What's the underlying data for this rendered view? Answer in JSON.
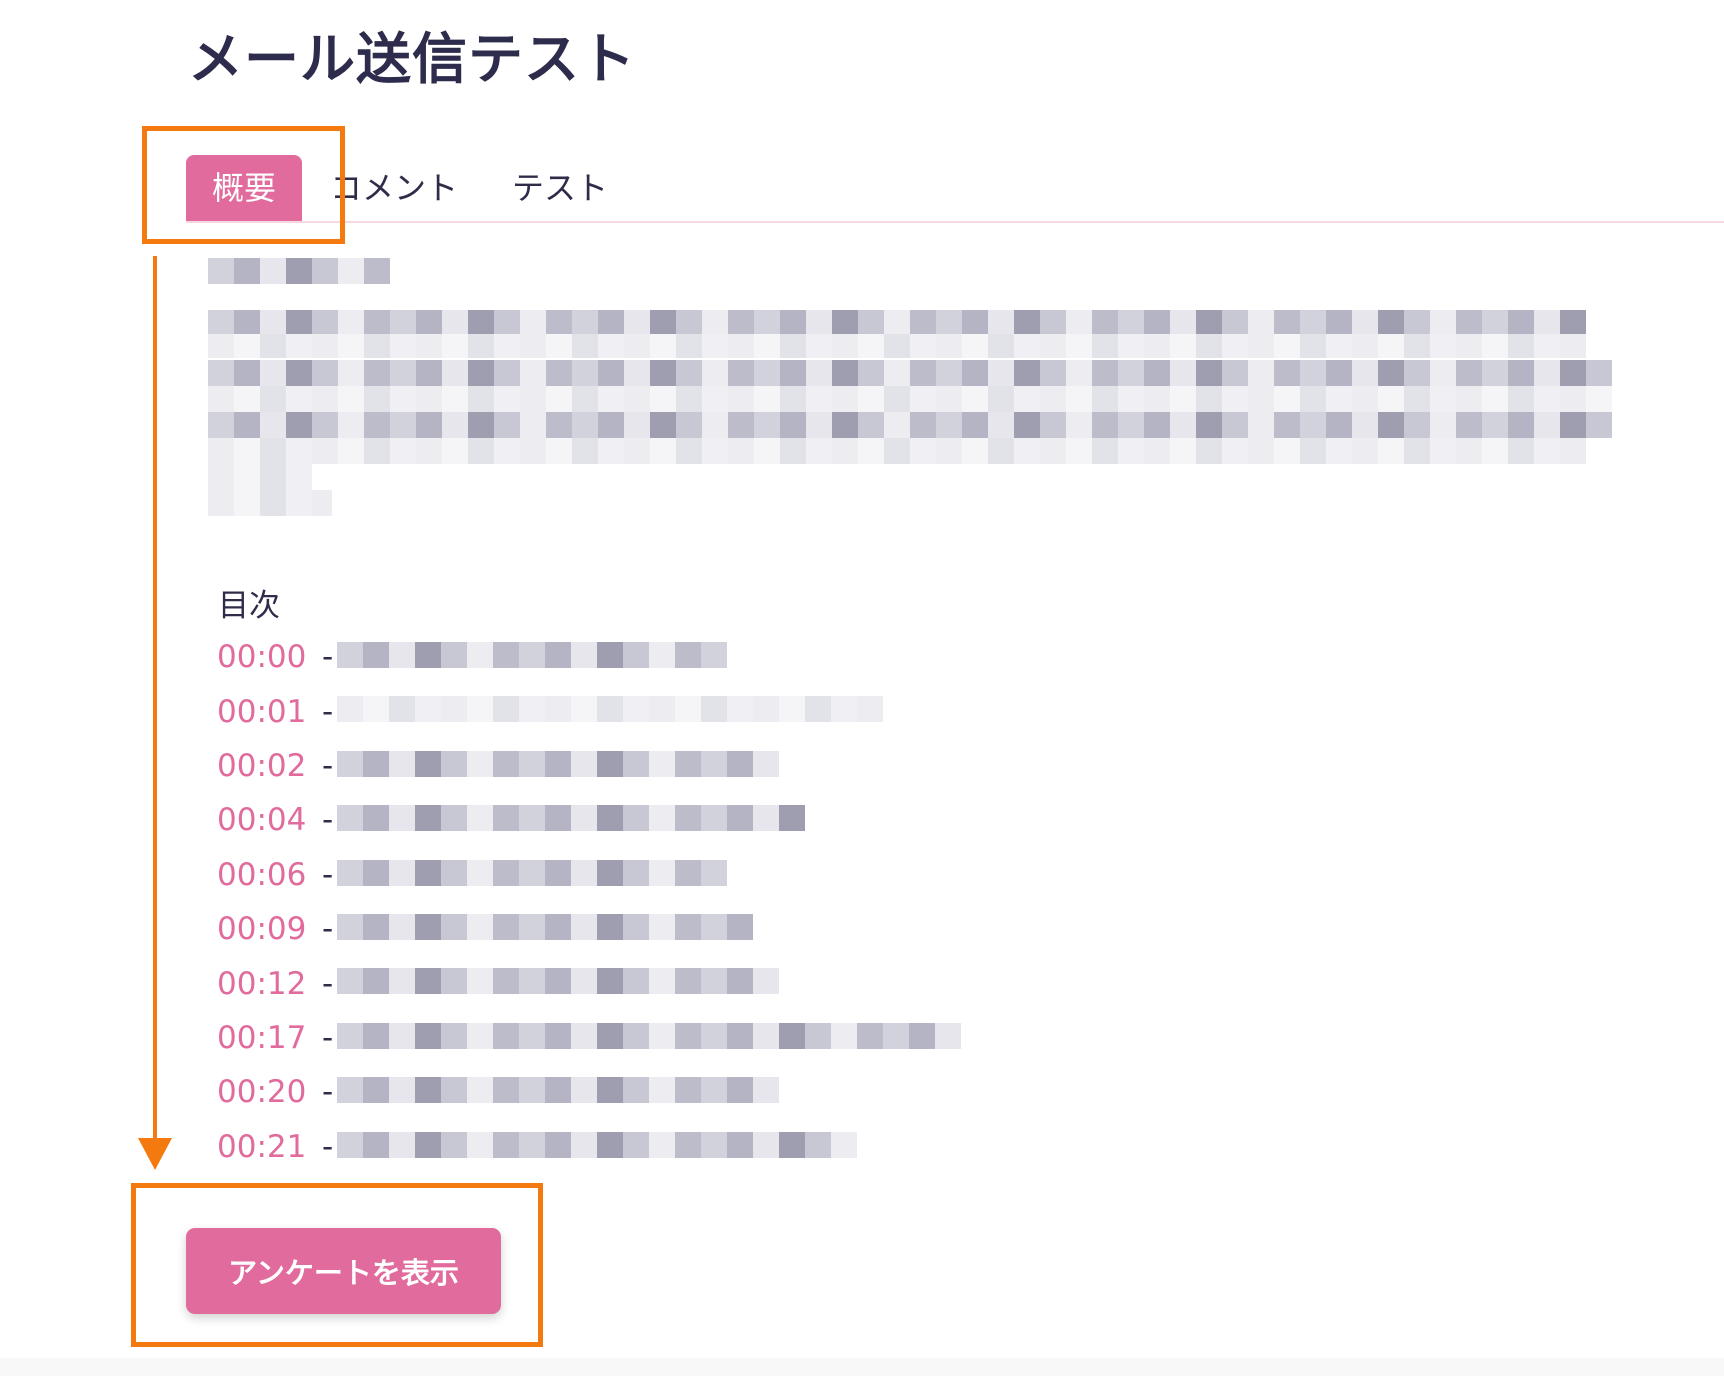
{
  "page": {
    "title": "メール送信テスト"
  },
  "tabs": [
    {
      "label": "概要",
      "active": true
    },
    {
      "label": "コメント",
      "active": false
    },
    {
      "label": "テスト",
      "active": false
    }
  ],
  "description": {
    "redacted": true
  },
  "toc": {
    "heading": "目次",
    "items": [
      {
        "time": "00:00",
        "separator": "-"
      },
      {
        "time": "00:01",
        "separator": "-"
      },
      {
        "time": "00:02",
        "separator": "-"
      },
      {
        "time": "00:04",
        "separator": "-"
      },
      {
        "time": "00:06",
        "separator": "-"
      },
      {
        "time": "00:09",
        "separator": "-"
      },
      {
        "time": "00:12",
        "separator": "-"
      },
      {
        "time": "00:17",
        "separator": "-"
      },
      {
        "time": "00:20",
        "separator": "-"
      },
      {
        "time": "00:21",
        "separator": "-"
      }
    ]
  },
  "survey": {
    "button_label": "アンケートを表示"
  },
  "colors": {
    "accent": "#e06b9c",
    "title": "#2e2c4c",
    "annotation": "#f47a10"
  }
}
